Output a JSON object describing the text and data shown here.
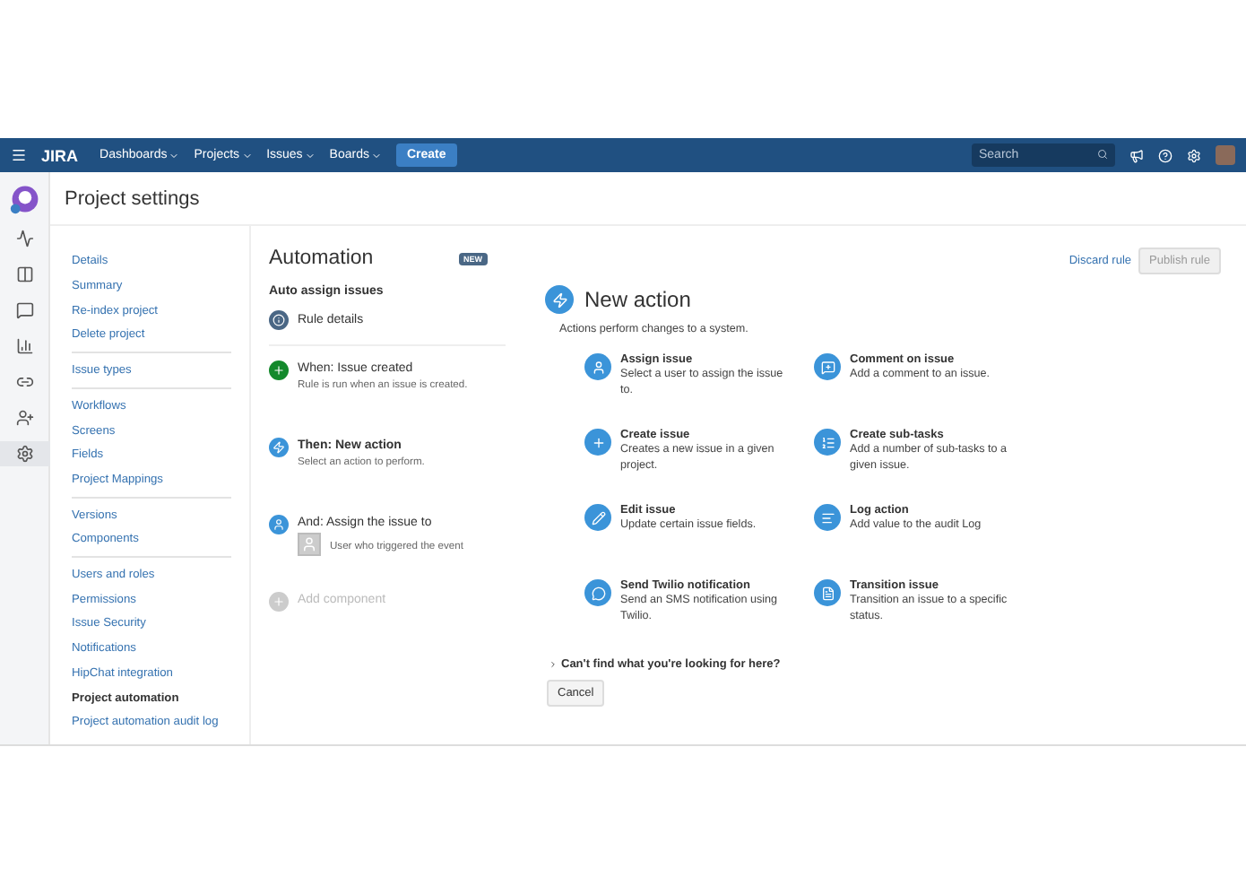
{
  "nav": {
    "logo": "JIRA",
    "menus": [
      {
        "label": "Dashboards"
      },
      {
        "label": "Projects"
      },
      {
        "label": "Issues"
      },
      {
        "label": "Boards"
      }
    ],
    "create": "Create",
    "search": {
      "placeholder": "Search"
    }
  },
  "page_title": "Project settings",
  "sidebar": {
    "groups": [
      {
        "items": [
          {
            "label": "Details",
            "selected": false
          },
          {
            "label": "Summary",
            "selected": false
          },
          {
            "label": "Re-index project",
            "selected": false
          },
          {
            "label": "Delete project",
            "selected": false
          }
        ]
      },
      {
        "items": [
          {
            "label": "Issue types",
            "selected": false
          }
        ]
      },
      {
        "items": [
          {
            "label": "Workflows",
            "selected": false
          },
          {
            "label": "Screens",
            "selected": false
          },
          {
            "label": "Fields",
            "selected": false
          },
          {
            "label": "Project Mappings",
            "selected": false
          }
        ]
      },
      {
        "items": [
          {
            "label": "Versions",
            "selected": false
          },
          {
            "label": "Components",
            "selected": false
          }
        ]
      },
      {
        "items": [
          {
            "label": "Users and roles",
            "selected": false
          },
          {
            "label": "Permissions",
            "selected": false
          },
          {
            "label": "Issue Security",
            "selected": false
          },
          {
            "label": "Notifications",
            "selected": false
          },
          {
            "label": "HipChat integration",
            "selected": false
          },
          {
            "label": "Project automation",
            "selected": true
          },
          {
            "label": "Project automation audit log",
            "selected": false
          }
        ]
      }
    ]
  },
  "rule": {
    "heading": "Automation",
    "badge": "NEW",
    "name": "Auto assign issues",
    "details": "Rule details",
    "steps": [
      {
        "kind": "trigger",
        "title": "When: Issue created",
        "subtitle": "Rule is run when an issue is created."
      },
      {
        "kind": "action",
        "title": "Then: New action",
        "subtitle": "Select an action to perform."
      },
      {
        "kind": "assign",
        "title": "And: Assign the issue to",
        "subtitle": "User who triggered the event"
      },
      {
        "kind": "add",
        "title": "Add component"
      }
    ]
  },
  "actions_panel": {
    "discard": "Discard rule",
    "publish": "Publish rule",
    "title": "New action",
    "description": "Actions perform changes to a system.",
    "actions": [
      {
        "title": "Assign issue",
        "description": "Select a user to assign the issue to."
      },
      {
        "title": "Comment on issue",
        "description": "Add a comment to an issue."
      },
      {
        "title": "Create issue",
        "description": "Creates a new issue in a given project."
      },
      {
        "title": "Create sub-tasks",
        "description": "Add a number of sub-tasks to a given issue."
      },
      {
        "title": "Edit issue",
        "description": "Update certain issue fields."
      },
      {
        "title": "Log action",
        "description": "Add value to the audit Log"
      },
      {
        "title": "Send Twilio notification",
        "description": "Send an SMS notification using Twilio."
      },
      {
        "title": "Transition issue",
        "description": "Transition an issue to a specific status."
      }
    ],
    "help": "Can't find what you're looking for here?",
    "cancel": "Cancel"
  }
}
